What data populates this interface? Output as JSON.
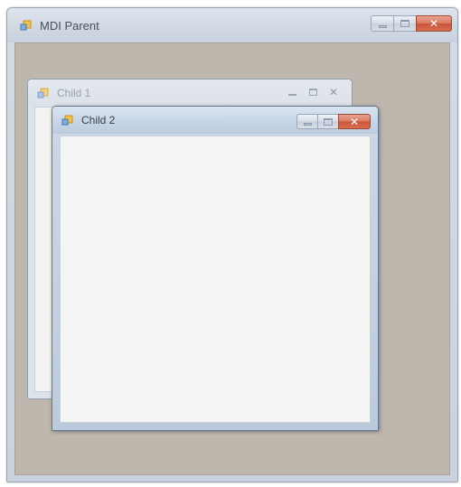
{
  "parent": {
    "title": "MDI Parent",
    "icon": "app-form-icon",
    "buttons": {
      "minimize": "minimize",
      "maximize": "maximize",
      "close": "close"
    }
  },
  "children": [
    {
      "title": "Child 1",
      "state": "inactive",
      "icon": "app-form-icon"
    },
    {
      "title": "Child 2",
      "state": "active",
      "icon": "app-form-icon"
    }
  ],
  "colors": {
    "mdi_background": "#bdb7ae",
    "close_button": "#d9785f",
    "active_frame": "#c6d5e6",
    "inactive_frame": "#dde3ea"
  }
}
